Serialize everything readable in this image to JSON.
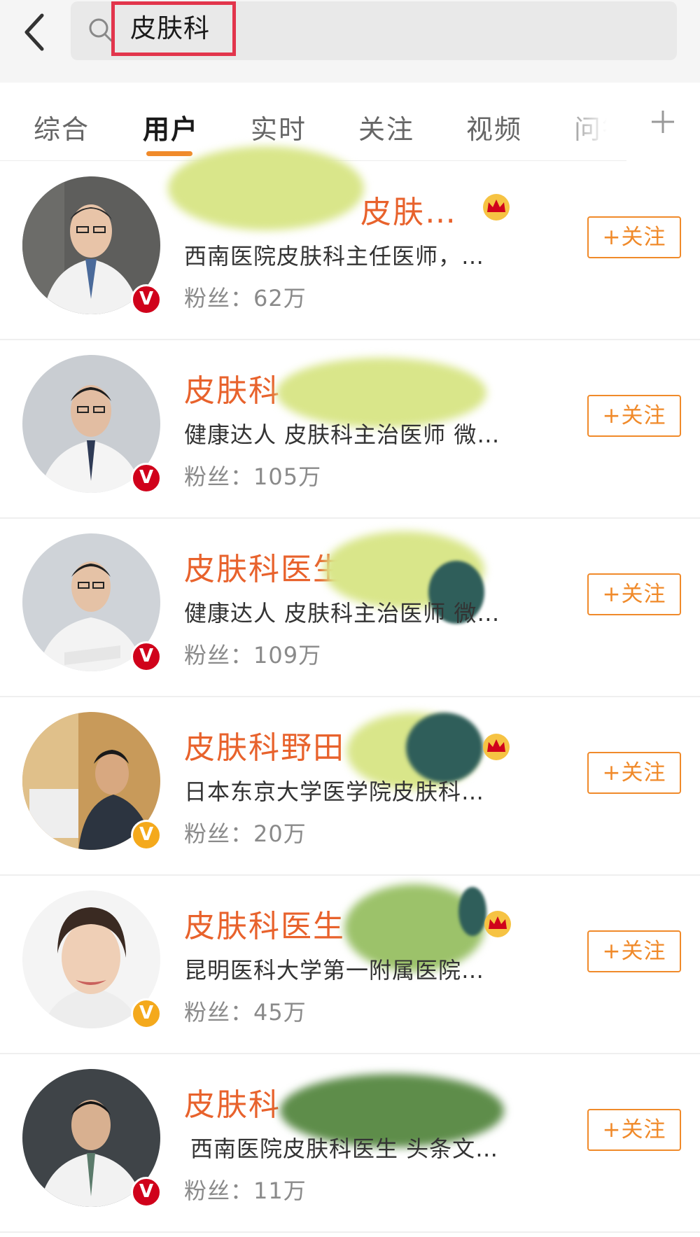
{
  "search": {
    "query": "皮肤科"
  },
  "tabs": [
    {
      "label": "综合"
    },
    {
      "label": "用户",
      "active": true
    },
    {
      "label": "实时"
    },
    {
      "label": "关注"
    },
    {
      "label": "视频"
    },
    {
      "label": "问答"
    }
  ],
  "follow_label": "+关注",
  "users": [
    {
      "name": "皮肤…",
      "desc": "西南医院皮肤科主任医师，…",
      "fans": "粉丝：62万",
      "badge": "V",
      "badge_color": "#d0021b",
      "level_icon": "crown-icon"
    },
    {
      "name": "皮肤科",
      "desc": "健康达人 皮肤科主治医师 微…",
      "fans": "粉丝：105万",
      "badge": "V",
      "badge_color": "#d0021b"
    },
    {
      "name": "皮肤科医生",
      "desc": "健康达人 皮肤科主治医师 微…",
      "fans": "粉丝：109万",
      "badge": "V",
      "badge_color": "#d0021b"
    },
    {
      "name": "皮肤科野田",
      "desc": "日本东京大学医学院皮肤科…",
      "fans": "粉丝：20万",
      "badge": "V",
      "badge_color": "#f4a91c",
      "level_icon": "crown-icon"
    },
    {
      "name": "皮肤科医生",
      "desc": "昆明医科大学第一附属医院…",
      "fans": "粉丝：45万",
      "badge": "V",
      "badge_color": "#f4a91c",
      "level_icon": "crown-icon"
    },
    {
      "name": "皮肤科",
      "desc": "西南医院皮肤科医生 头条文…",
      "fans": "粉丝：11万",
      "badge": "V",
      "badge_color": "#d0021b"
    }
  ],
  "colors": {
    "accent": "#f08a2a",
    "name": "#e8622c",
    "highlight_box": "#e2354c"
  }
}
